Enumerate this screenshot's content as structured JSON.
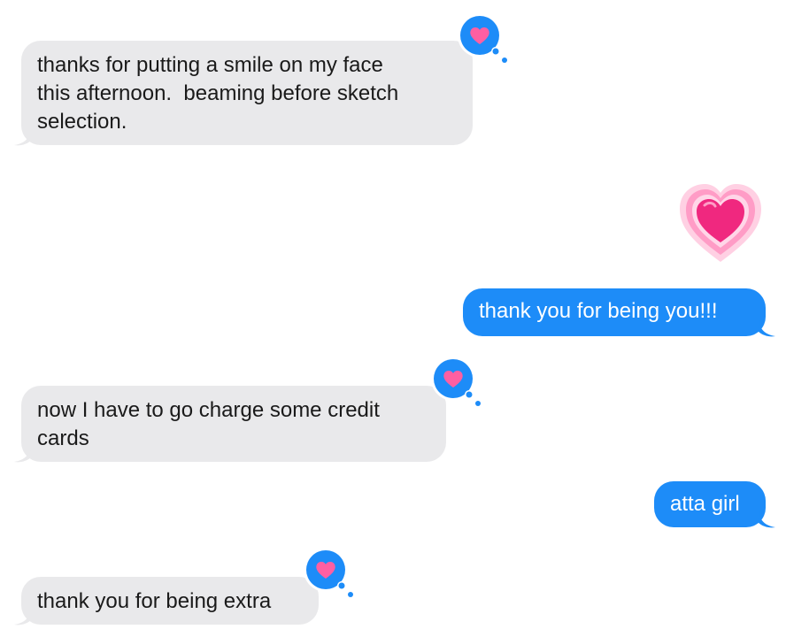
{
  "conversation": {
    "messages": [
      {
        "direction": "incoming",
        "text": "thanks for putting a smile on my face\nthis afternoon.  beaming before sketch\nselection.",
        "reaction": "heart"
      },
      {
        "direction": "outgoing",
        "text": "",
        "emoji": "growing-heart"
      },
      {
        "direction": "outgoing",
        "text": "thank you for being you!!!"
      },
      {
        "direction": "incoming",
        "text": "now I have to go charge some credit\ncards",
        "reaction": "heart"
      },
      {
        "direction": "outgoing",
        "text": "atta girl"
      },
      {
        "direction": "incoming",
        "text": "thank you for being extra",
        "reaction": "heart"
      }
    ]
  },
  "colors": {
    "incoming_bubble": "#e9e9eb",
    "outgoing_bubble": "#1d8cf8",
    "tapback_circle": "#1d8cf8",
    "tapback_heart": "#ff5fa2",
    "emoji_heart": "#f0287f"
  },
  "icons": {
    "reaction": "heart-icon",
    "emoji": "growing-heart-emoji"
  }
}
